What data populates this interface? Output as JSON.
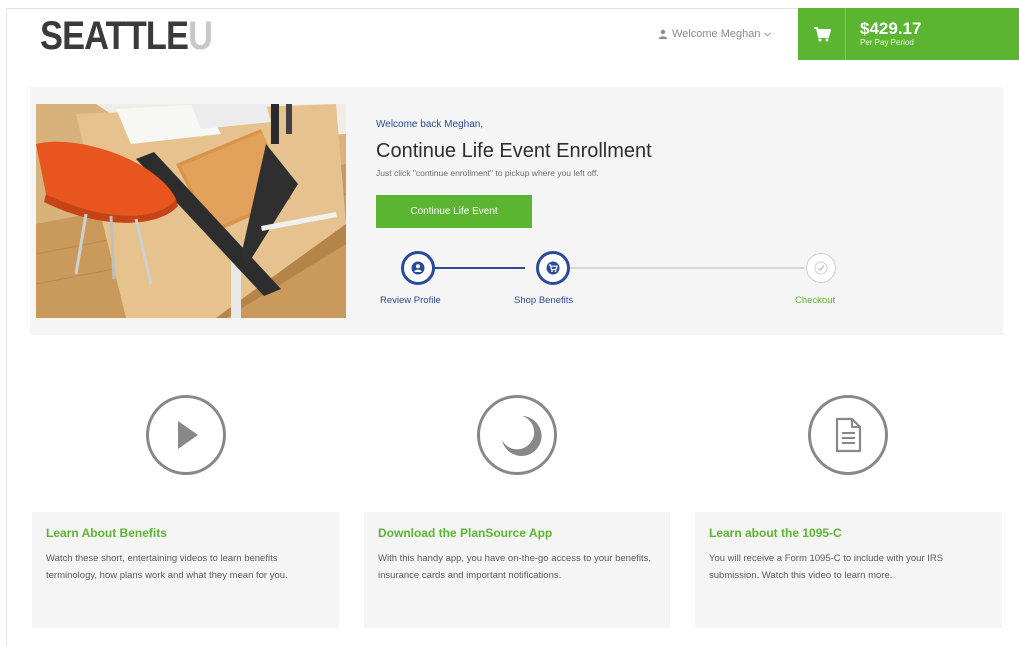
{
  "header": {
    "logo_main": "SEATTLE",
    "logo_accent": "U",
    "welcome": "Welcome Meghan",
    "cart_amount": "$429.17",
    "cart_period": "Per Pay Period",
    "icons": [
      "user-icon",
      "chevron-down-icon",
      "cart-icon"
    ]
  },
  "enrollment": {
    "welcome_back": "Welcome back Meghan,",
    "title": "Continue Life Event Enrollment",
    "subtitle": "Just click \"continue enrollment\" to pickup where you left off.",
    "button": "Continue Life Event",
    "steps": [
      {
        "label": "Review Profile",
        "status": "complete",
        "icon": "user-icon"
      },
      {
        "label": "Shop Benefits",
        "status": "current",
        "icon": "cart-icon"
      },
      {
        "label": "Checkout",
        "status": "pending",
        "icon": "checkmark-icon"
      }
    ]
  },
  "features": [
    {
      "icon": "play-icon",
      "title": "Learn About Benefits",
      "text": "Watch these short, entertaining videos to learn benefits terminology, how plans work and what they mean for you."
    },
    {
      "icon": "app-icon",
      "title": "Download the PlanSource App",
      "text": "With this handy app, you have on-the-go access to your benefits, insurance cards and important notifications."
    },
    {
      "icon": "document-icon",
      "title": "Learn about the 1095-C",
      "text": "You will receive a Form 1095-C to include with your IRS submission. Watch this video to learn more."
    }
  ],
  "colors": {
    "brand_green": "#5cb531",
    "brand_blue": "#2a4b9b",
    "panel_bg": "#f5f5f5",
    "icon_gray": "#888888"
  }
}
